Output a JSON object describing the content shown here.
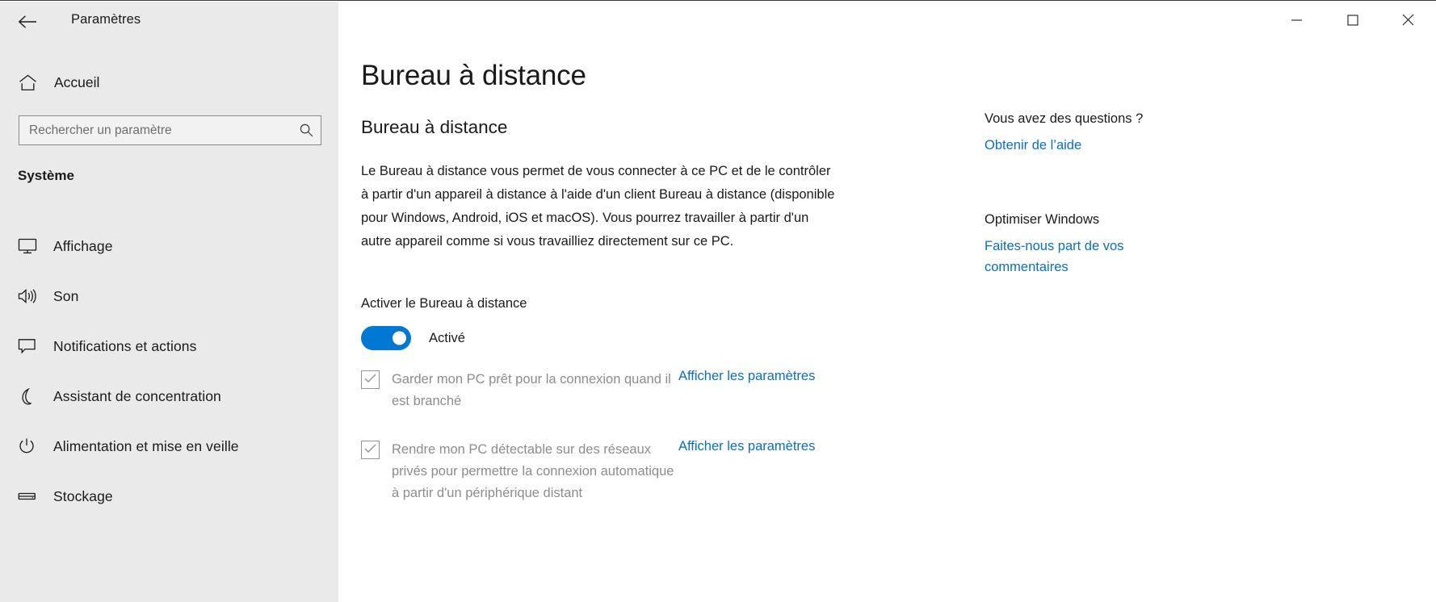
{
  "window": {
    "title": "Paramètres",
    "back_icon": "back-arrow-icon",
    "minimize_label": "—",
    "maximize_label": "□",
    "close_label": "✕"
  },
  "sidebar": {
    "home_label": "Accueil",
    "home_icon": "home-icon",
    "search": {
      "placeholder": "Rechercher un paramètre",
      "value": "",
      "icon": "search-icon"
    },
    "section_heading": "Système",
    "items": [
      {
        "label": "Affichage",
        "icon": "monitor-icon"
      },
      {
        "label": "Son",
        "icon": "speaker-icon"
      },
      {
        "label": "Notifications et actions",
        "icon": "chat-bubble-icon"
      },
      {
        "label": "Assistant de concentration",
        "icon": "moon-icon"
      },
      {
        "label": "Alimentation et mise en veille",
        "icon": "power-icon"
      },
      {
        "label": "Stockage",
        "icon": "drive-icon"
      }
    ]
  },
  "main": {
    "page_title": "Bureau à distance",
    "section_title": "Bureau à distance",
    "description": "Le Bureau à distance vous permet de vous connecter à ce PC et de le contrôler à partir d'un appareil à distance à l'aide d'un client Bureau à distance (disponible pour Windows, Android, iOS et macOS). Vous pourrez travailler à partir d'un autre appareil comme si vous travailliez directement sur ce PC.",
    "toggle_label": "Activer le Bureau à distance",
    "toggle_state": "Activé",
    "toggle_on": true,
    "accent_color": "#0078d4",
    "link_color": "#0b6ec4",
    "options": [
      {
        "label": "Garder mon PC prêt pour la connexion quand il est branché",
        "link": "Afficher les paramètres",
        "checked": true,
        "disabled": true
      },
      {
        "label": "Rendre mon PC détectable sur des réseaux privés pour permettre la connexion automatique à partir d'un périphérique distant",
        "link": "Afficher les paramètres",
        "checked": true,
        "disabled": true
      }
    ]
  },
  "right_panel": {
    "questions_heading": "Vous avez des questions ?",
    "help_link": "Obtenir de l’aide",
    "improve_heading": "Optimiser Windows",
    "feedback_link": "Faites-nous part de vos commentaires"
  }
}
